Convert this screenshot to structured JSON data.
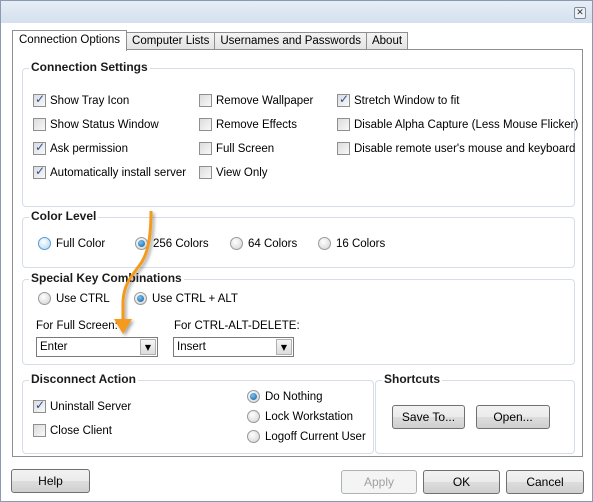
{
  "window": {
    "close_icon": "close-icon"
  },
  "tabs": [
    {
      "label": "Connection Options",
      "active": true
    },
    {
      "label": "Computer Lists",
      "active": false
    },
    {
      "label": "Usernames and Passwords",
      "active": false
    },
    {
      "label": "About",
      "active": false
    }
  ],
  "connection_settings": {
    "title": "Connection Settings",
    "options": [
      {
        "label": "Show Tray Icon",
        "checked": true
      },
      {
        "label": "Show Status Window",
        "checked": false
      },
      {
        "label": "Ask permission",
        "checked": true
      },
      {
        "label": "Automatically install server",
        "checked": true
      },
      {
        "label": "Remove Wallpaper",
        "checked": false
      },
      {
        "label": "Remove Effects",
        "checked": false
      },
      {
        "label": "Full Screen",
        "checked": false
      },
      {
        "label": "View Only",
        "checked": false
      },
      {
        "label": "Stretch Window to fit",
        "checked": true
      },
      {
        "label": "Disable Alpha Capture (Less Mouse Flicker)",
        "checked": false
      },
      {
        "label": "Disable remote user's mouse and keyboard",
        "checked": false
      }
    ]
  },
  "color_level": {
    "title": "Color Level",
    "options": [
      {
        "label": "Full Color",
        "selected": false
      },
      {
        "label": "256 Colors",
        "selected": true
      },
      {
        "label": "64 Colors",
        "selected": false
      },
      {
        "label": "16 Colors",
        "selected": false
      }
    ]
  },
  "special_keys": {
    "title": "Special Key Combinations",
    "options": [
      {
        "label": "Use CTRL",
        "selected": false
      },
      {
        "label": "Use CTRL + ALT",
        "selected": true
      }
    ],
    "full_screen_label": "For Full Screen:",
    "full_screen_value": "Enter",
    "cad_label": "For CTRL-ALT-DELETE:",
    "cad_value": "Insert"
  },
  "disconnect_action": {
    "title": "Disconnect Action",
    "checks": [
      {
        "label": "Uninstall Server",
        "checked": true
      },
      {
        "label": "Close Client",
        "checked": false
      }
    ],
    "radios": [
      {
        "label": "Do Nothing",
        "selected": true
      },
      {
        "label": "Lock Workstation",
        "selected": false
      },
      {
        "label": "Logoff Current User",
        "selected": false
      }
    ]
  },
  "shortcuts": {
    "title": "Shortcuts",
    "save_label": "Save To...",
    "open_label": "Open..."
  },
  "footer": {
    "help_label": "Help",
    "apply_label": "Apply",
    "ok_label": "OK",
    "cancel_label": "Cancel"
  },
  "annotation": {
    "color": "#f59a1b"
  }
}
